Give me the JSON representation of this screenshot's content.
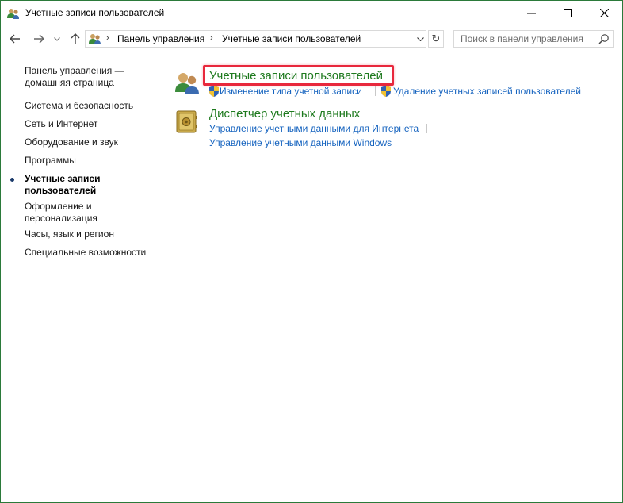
{
  "window": {
    "title": "Учетные записи пользователей",
    "controls": {
      "minimize": "—",
      "maximize": "☐",
      "close": "✕"
    }
  },
  "nav": {
    "back": "←",
    "forward": "→",
    "recent": "⌄",
    "up": "↑"
  },
  "address": {
    "crumbs": [
      "Панель управления",
      "Учетные записи пользователей"
    ],
    "separator": "›",
    "dropdown": "⌄",
    "refresh": "↻"
  },
  "search": {
    "placeholder": "Поиск в панели управления"
  },
  "sidebar": {
    "items": [
      {
        "label": "Панель управления —",
        "label2": "домашняя страница",
        "active": false
      },
      {
        "label": "Система и безопасность",
        "active": false
      },
      {
        "label": "Сеть и Интернет",
        "active": false
      },
      {
        "label": "Оборудование и звук",
        "active": false
      },
      {
        "label": "Программы",
        "active": false
      },
      {
        "label": "Учетные записи",
        "label2": "пользователей",
        "active": true
      },
      {
        "label": "Оформление и",
        "label2": "персонализация",
        "active": false
      },
      {
        "label": "Часы, язык и регион",
        "active": false
      },
      {
        "label": "Специальные возможности",
        "active": false
      }
    ]
  },
  "sections": [
    {
      "title": "Учетные записи пользователей",
      "icon": "users-icon",
      "links": [
        "Изменение типа учетной записи",
        "Удаление учетных записей пользователей"
      ]
    },
    {
      "title": "Диспетчер учетных данных",
      "icon": "vault-icon",
      "links": [
        "Управление учетными данными для Интернета",
        "Управление учетными данными Windows"
      ]
    }
  ],
  "colors": {
    "window_border": "#2b7a3a",
    "section_title": "#1e7a1e",
    "link": "#1563bf",
    "highlight": "#e8283c"
  }
}
